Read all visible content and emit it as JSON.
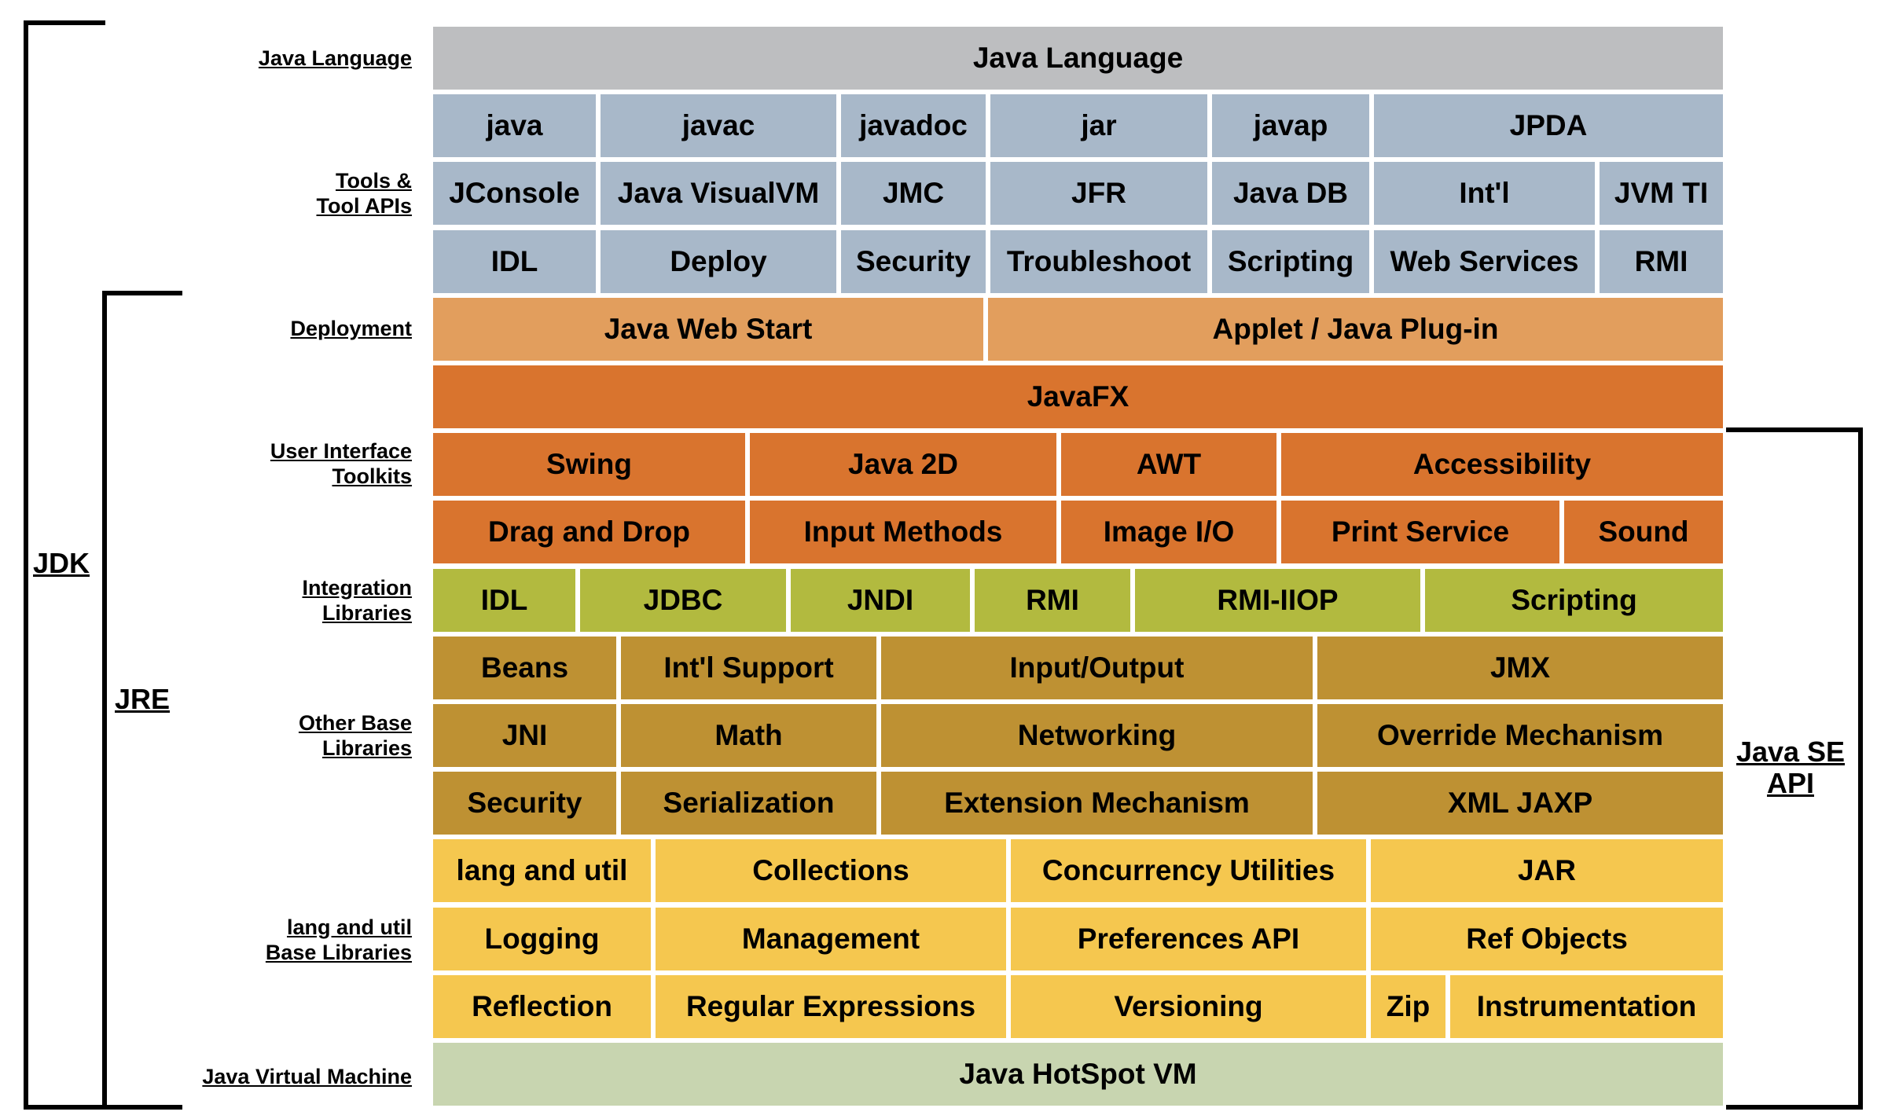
{
  "brackets": {
    "jdk": "JDK",
    "jre": "JRE",
    "java_se_api_line1": "Java SE",
    "java_se_api_line2": "API"
  },
  "colors": {
    "language": "#bdbec0",
    "tools": "#a8b8c9",
    "deployment": "#e29e5d",
    "ui": "#d9742e",
    "integration": "#b2ba3f",
    "other": "#be9133",
    "lang_util": "#f5c74f",
    "vm": "#c8d5b0"
  },
  "row_labels": [
    {
      "name": "java-language",
      "lines": [
        "Java Language"
      ]
    },
    {
      "name": "tools",
      "lines": [
        "Tools &",
        "Tool APIs"
      ]
    },
    {
      "name": "deployment",
      "lines": [
        "Deployment"
      ]
    },
    {
      "name": "ui-toolkits",
      "lines": [
        "User Interface",
        "Toolkits"
      ]
    },
    {
      "name": "integration",
      "lines": [
        "Integration",
        "Libraries"
      ]
    },
    {
      "name": "other-base",
      "lines": [
        "Other Base",
        "Libraries"
      ]
    },
    {
      "name": "lang-util",
      "lines": [
        "lang and util",
        "Base Libraries"
      ]
    },
    {
      "name": "jvm",
      "lines": [
        "Java Virtual Machine"
      ]
    }
  ],
  "rows": [
    {
      "color": "language",
      "cells": [
        "Java Language"
      ]
    },
    {
      "color": "tools",
      "cells": [
        "java",
        "javac",
        "javadoc",
        "jar",
        "javap",
        "JPDA"
      ]
    },
    {
      "color": "tools",
      "cells": [
        "JConsole",
        "Java VisualVM",
        "JMC",
        "JFR",
        "Java DB",
        "Int'l",
        "JVM TI"
      ]
    },
    {
      "color": "tools",
      "cells": [
        "IDL",
        "Deploy",
        "Security",
        "Troubleshoot",
        "Scripting",
        "Web Services",
        "RMI"
      ]
    },
    {
      "color": "deployment",
      "cells": [
        "Java Web Start",
        "Applet / Java Plug-in"
      ]
    },
    {
      "color": "ui",
      "cells": [
        "JavaFX"
      ]
    },
    {
      "color": "ui",
      "cells": [
        "Swing",
        "Java 2D",
        "AWT",
        "Accessibility"
      ]
    },
    {
      "color": "ui",
      "cells": [
        "Drag and Drop",
        "Input Methods",
        "Image I/O",
        "Print Service",
        "Sound"
      ]
    },
    {
      "color": "integration",
      "cells": [
        "IDL",
        "JDBC",
        "JNDI",
        "RMI",
        "RMI-IIOP",
        "Scripting"
      ]
    },
    {
      "color": "other",
      "cells": [
        "Beans",
        "Int'l Support",
        "Input/Output",
        "JMX"
      ]
    },
    {
      "color": "other",
      "cells": [
        "JNI",
        "Math",
        "Networking",
        "Override Mechanism"
      ]
    },
    {
      "color": "other",
      "cells": [
        "Security",
        "Serialization",
        "Extension Mechanism",
        "XML JAXP"
      ]
    },
    {
      "color": "lang_util",
      "cells": [
        "lang and util",
        "Collections",
        "Concurrency Utilities",
        "JAR"
      ]
    },
    {
      "color": "lang_util",
      "cells": [
        "Logging",
        "Management",
        "Preferences API",
        "Ref Objects"
      ]
    },
    {
      "color": "lang_util",
      "cells": [
        "Reflection",
        "Regular Expressions",
        "Versioning",
        "Zip",
        "Instrumentation"
      ]
    },
    {
      "color": "vm",
      "cells": [
        "Java HotSpot VM"
      ]
    }
  ]
}
